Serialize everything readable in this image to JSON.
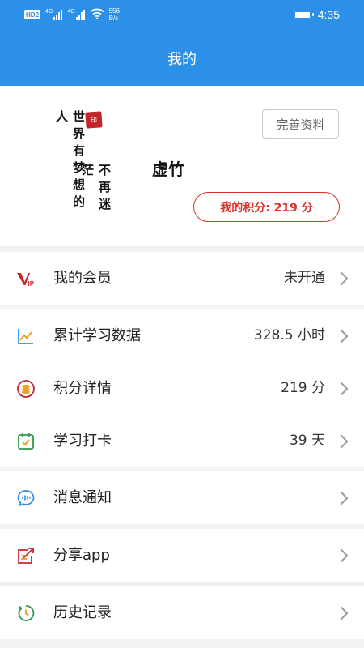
{
  "status_bar": {
    "hd_badge": "HD",
    "sim_slot": "2",
    "network_1": "4G",
    "network_2": "4G",
    "speed_value": "556",
    "speed_unit": "B/s",
    "time": "4:35",
    "battery_level": 0.9
  },
  "header": {
    "title": "我的"
  },
  "profile": {
    "calligraphy_line_1": "世界有梦想的人",
    "calligraphy_line_2": "不再迷茫",
    "seal_text": "印",
    "username": "虚竹",
    "edit_button_label": "完善资料",
    "points_label": "我的积分: 219 分"
  },
  "menu": {
    "membership": {
      "label": "我的会员",
      "value": "未开通",
      "icon": "vip-icon"
    },
    "study_data": {
      "label": "累计学习数据",
      "value": "328.5 小时",
      "icon": "trend-chart-icon"
    },
    "points_detail": {
      "label": "积分详情",
      "value": "219 分",
      "icon": "coin-icon"
    },
    "checkin": {
      "label": "学习打卡",
      "value": "39 天",
      "icon": "calendar-check-icon"
    },
    "messages": {
      "label": "消息通知",
      "icon": "message-bubble-icon"
    },
    "share": {
      "label": "分享app",
      "icon": "share-icon"
    },
    "history": {
      "label": "历史记录",
      "icon": "clock-history-icon"
    }
  },
  "colors": {
    "primary_blue": "#2d90e8",
    "accent_red": "#d9342b",
    "icon_orange": "#f0a020",
    "icon_green": "#2f9a46",
    "icon_blue": "#2d90e8",
    "background": "#f2f2f2"
  }
}
